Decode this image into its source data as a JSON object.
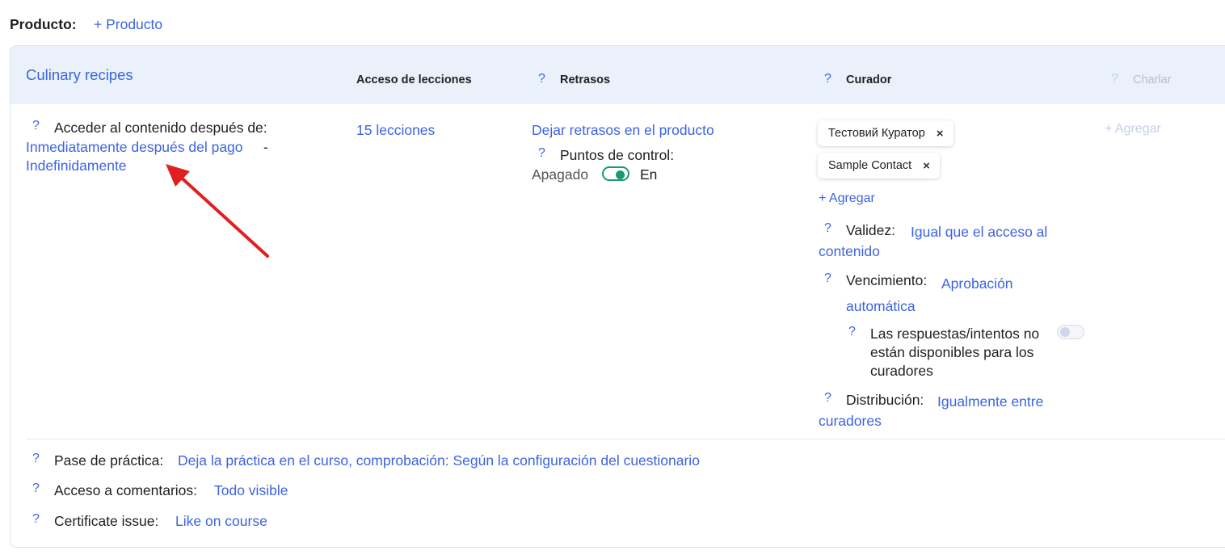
{
  "product": {
    "label": "Producto:",
    "add_link": "+ Producto"
  },
  "card": {
    "title": "Culinary recipes",
    "headers": {
      "lesson_access": "Acceso de lecciones",
      "delays": "Retrasos",
      "curator": "Curador",
      "chat": "Charlar"
    },
    "access": {
      "label": "Acceder al contenido después de:",
      "start_link": "Inmediatamente después del pago",
      "separator": "-",
      "end_link": "Indefinidamente"
    },
    "lessons_link": "15 lecciones",
    "delays": {
      "link": "Dejar retrasos en el producto",
      "checkpoints_label": "Puntos de control:",
      "off_label": "Apagado",
      "on_label": "En",
      "checkpoints_enabled": true
    },
    "curator": {
      "chips": [
        {
          "name": "Тестовий Куратор"
        },
        {
          "name": "Sample Contact"
        }
      ],
      "add_link": "+ Agregar",
      "validity_label": "Validez:",
      "validity_value": "Igual que el acceso al contenido",
      "expiry_label": "Vencimiento:",
      "expiry_value": "Aprobación automática",
      "answers_label": "Las respuestas/intentos no están disponibles para los curadores",
      "answers_enabled": false,
      "distribution_label": "Distribución:",
      "distribution_value": "Igualmente entre curadores"
    },
    "chat": {
      "add_link": "+ Agregar"
    },
    "bottom": {
      "practice_label": "Pase de práctica:",
      "practice_value": "Deja la práctica en el curso, comprobación: Según la configuración del cuestionario",
      "comments_label": "Acceso a comentarios:",
      "comments_value": "Todo visible",
      "certificate_label": "Certificate issue:",
      "certificate_value": "Like on course"
    },
    "help_glyph": "?"
  },
  "colors": {
    "link": "#3c64e0",
    "header_bg": "#eaf1fb",
    "toggle_on": "#1c9a6a",
    "arrow": "#e02020"
  }
}
